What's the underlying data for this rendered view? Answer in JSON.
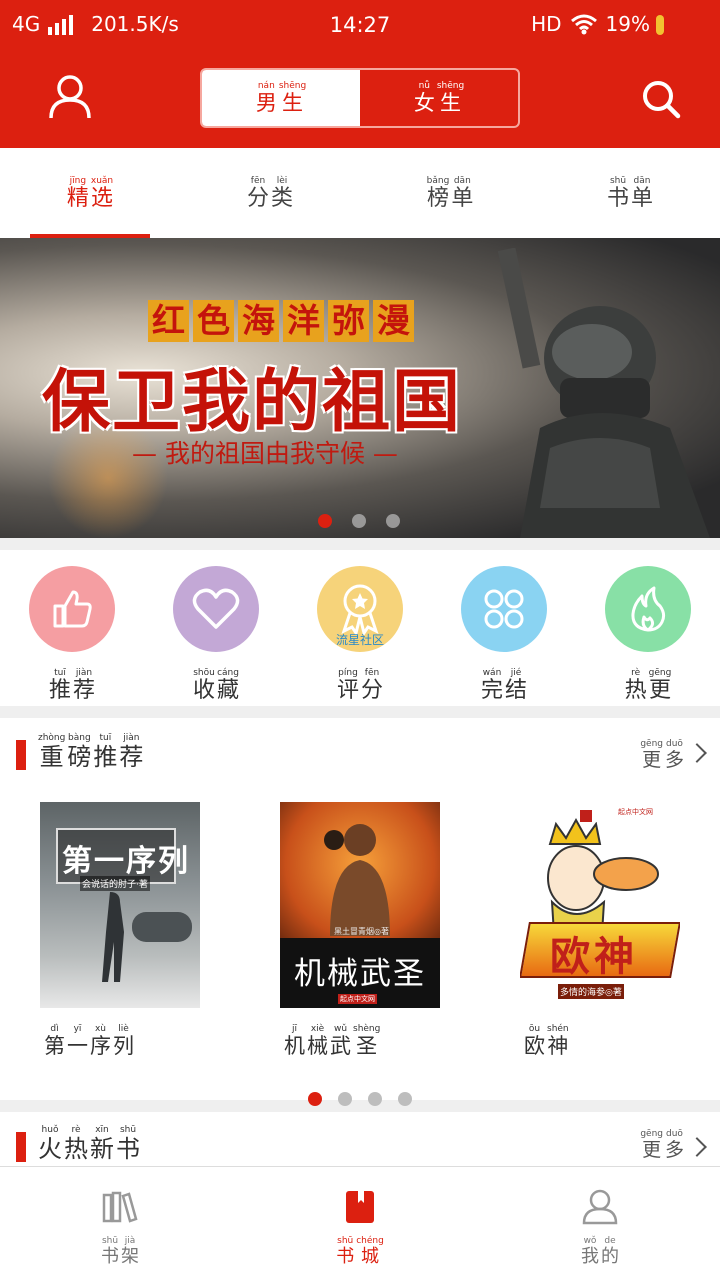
{
  "status_bar": {
    "network": "4G",
    "speed": "201.5K/s",
    "time": "14:27",
    "hd": "HD",
    "battery": "19%"
  },
  "header": {
    "user_icon": "user-icon",
    "search_icon": "search-icon",
    "gender_tabs": [
      {
        "chars": [
          {
            "py": "nán",
            "hz": "男"
          },
          {
            "py": "shēng",
            "hz": "生"
          }
        ],
        "active": true
      },
      {
        "chars": [
          {
            "py": "nǚ",
            "hz": "女"
          },
          {
            "py": "shēng",
            "hz": "生"
          }
        ],
        "active": false
      }
    ]
  },
  "tabs": [
    {
      "chars": [
        {
          "py": "jīng",
          "hz": "精"
        },
        {
          "py": "xuǎn",
          "hz": "选"
        }
      ],
      "active": true
    },
    {
      "chars": [
        {
          "py": "fēn",
          "hz": "分"
        },
        {
          "py": "lèi",
          "hz": "类"
        }
      ],
      "active": false
    },
    {
      "chars": [
        {
          "py": "bǎng",
          "hz": "榜"
        },
        {
          "py": "dān",
          "hz": "单"
        }
      ],
      "active": false
    },
    {
      "chars": [
        {
          "py": "shū",
          "hz": "书"
        },
        {
          "py": "dān",
          "hz": "单"
        }
      ],
      "active": false
    }
  ],
  "banner": {
    "tag": [
      "红",
      "色",
      "海",
      "洋",
      "弥",
      "漫"
    ],
    "title": "保卫我的祖国",
    "subtitle": "— 我的祖国由我守候 —",
    "slide_count": 3,
    "active_slide": 0
  },
  "quick_entries": [
    {
      "icon": "thumbs-up-icon",
      "color": "#f59ea2",
      "chars": [
        {
          "py": "tuī",
          "hz": "推"
        },
        {
          "py": "jiàn",
          "hz": "荐"
        }
      ]
    },
    {
      "icon": "heart-icon",
      "color": "#c3a8d6",
      "chars": [
        {
          "py": "shōu",
          "hz": "收"
        },
        {
          "py": "cáng",
          "hz": "藏"
        }
      ]
    },
    {
      "icon": "medal-icon",
      "color": "#f6d37a",
      "chars": [
        {
          "py": "píng",
          "hz": "评"
        },
        {
          "py": "fēn",
          "hz": "分"
        }
      ]
    },
    {
      "icon": "clover-icon",
      "color": "#8ad3f2",
      "chars": [
        {
          "py": "wán",
          "hz": "完"
        },
        {
          "py": "jié",
          "hz": "结"
        }
      ]
    },
    {
      "icon": "flame-icon",
      "color": "#88e0a6",
      "chars": [
        {
          "py": "rè",
          "hz": "热"
        },
        {
          "py": "gēng",
          "hz": "更"
        }
      ]
    }
  ],
  "watermark": "流星社区",
  "recommend": {
    "title": [
      {
        "py": "zhòng",
        "hz": "重"
      },
      {
        "py": "bàng",
        "hz": "磅"
      },
      {
        "py": "tuī",
        "hz": "推"
      },
      {
        "py": "jiàn",
        "hz": "荐"
      }
    ],
    "more": [
      {
        "py": "gēng",
        "hz": "更"
      },
      {
        "py": "duō",
        "hz": "多"
      }
    ],
    "books": [
      {
        "cover_title": "第一序列",
        "cover_author": "会说话的肘子·著",
        "chars": [
          {
            "py": "dì",
            "hz": "第"
          },
          {
            "py": "yī",
            "hz": "一"
          },
          {
            "py": "xù",
            "hz": "序"
          },
          {
            "py": "liè",
            "hz": "列"
          }
        ]
      },
      {
        "cover_title": "机械武圣",
        "cover_author": "黑土冒青烟◎著",
        "cover_brand": "起点中文网",
        "chars": [
          {
            "py": "jī",
            "hz": "机"
          },
          {
            "py": "xiè",
            "hz": "械"
          },
          {
            "py": "wǔ",
            "hz": "武"
          },
          {
            "py": "shèng",
            "hz": "圣"
          }
        ]
      },
      {
        "cover_title": "欧神",
        "cover_author": "多情的海参◎著",
        "cover_brand": "起点中文网",
        "chars": [
          {
            "py": "ōu",
            "hz": "欧"
          },
          {
            "py": "shén",
            "hz": "神"
          }
        ]
      }
    ],
    "page_count": 4,
    "active_page": 0
  },
  "hot_new": {
    "title": [
      {
        "py": "huǒ",
        "hz": "火"
      },
      {
        "py": "rè",
        "hz": "热"
      },
      {
        "py": "xīn",
        "hz": "新"
      },
      {
        "py": "shū",
        "hz": "书"
      }
    ],
    "more": [
      {
        "py": "gēng",
        "hz": "更"
      },
      {
        "py": "duō",
        "hz": "多"
      }
    ]
  },
  "bottom_nav": [
    {
      "icon": "bookshelf-icon",
      "chars": [
        {
          "py": "shū",
          "hz": "书"
        },
        {
          "py": "jià",
          "hz": "架"
        }
      ],
      "active": false
    },
    {
      "icon": "bookstore-icon",
      "chars": [
        {
          "py": "shū",
          "hz": "书"
        },
        {
          "py": "chéng",
          "hz": "城"
        }
      ],
      "active": true
    },
    {
      "icon": "profile-icon",
      "chars": [
        {
          "py": "wǒ",
          "hz": "我"
        },
        {
          "py": "de",
          "hz": "的"
        }
      ],
      "active": false
    }
  ],
  "colors": {
    "brand_red": "#dc2010",
    "background": "#efefef"
  }
}
